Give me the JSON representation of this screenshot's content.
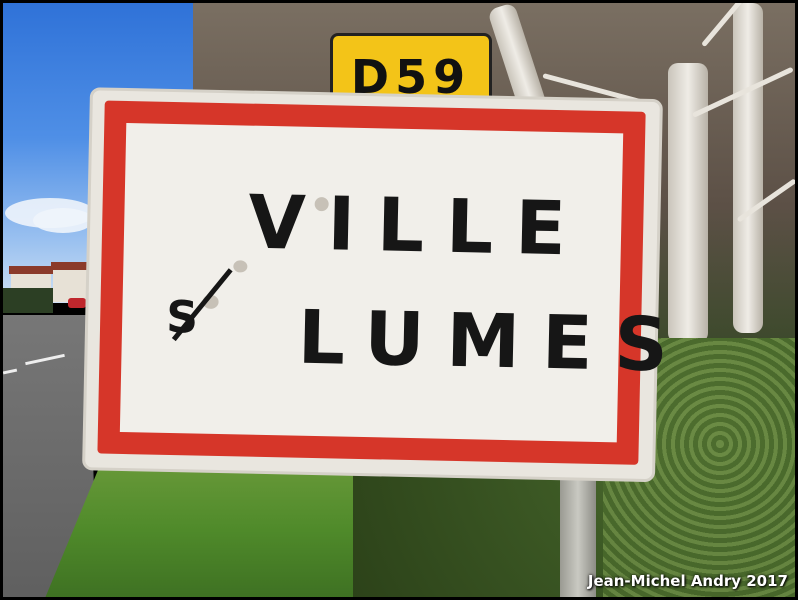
{
  "route_plate": {
    "text": "D59",
    "color": "#f3c418"
  },
  "town_sign": {
    "line1": "VILLE",
    "prefix": "S",
    "line2": "LUMES",
    "border_color": "#d63629",
    "background_color": "#f1efea"
  },
  "credit": "Jean-Michel Andry 2017"
}
